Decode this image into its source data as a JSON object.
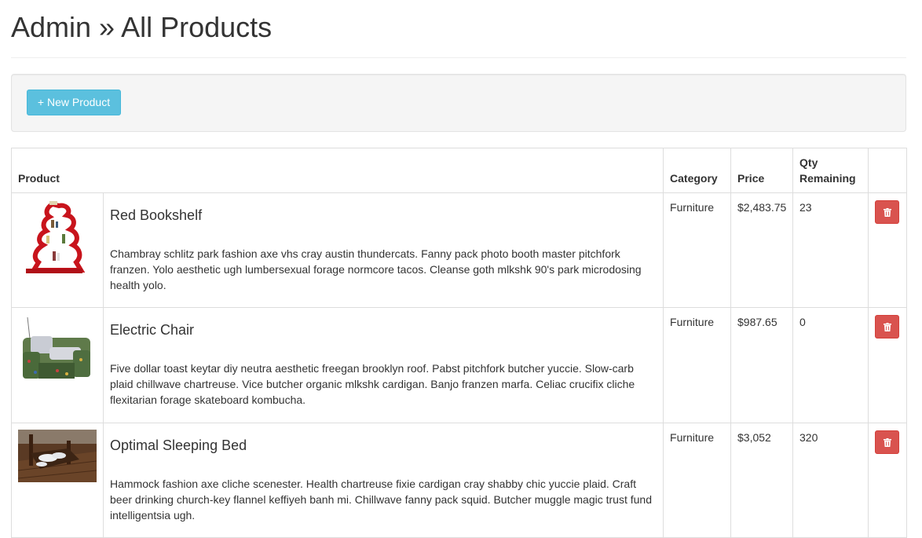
{
  "header": {
    "title": "Admin » All Products"
  },
  "toolbar": {
    "new_product_label": "+ New Product"
  },
  "table": {
    "columns": {
      "product": "Product",
      "category": "Category",
      "price": "Price",
      "qty": "Qty Remaining"
    },
    "rows": [
      {
        "name": "Red Bookshelf",
        "description": "Chambray schlitz park fashion axe vhs cray austin thundercats. Fanny pack photo booth master pitchfork franzen. Yolo aesthetic ugh lumbersexual forage normcore tacos. Cleanse goth mlkshk 90's park microdosing health yolo.",
        "category": "Furniture",
        "price": "$2,483.75",
        "qty": "23",
        "image": "red-bookshelf-image"
      },
      {
        "name": "Electric Chair",
        "description": "Five dollar toast keytar diy neutra aesthetic freegan brooklyn roof. Pabst pitchfork butcher yuccie. Slow-carb plaid chillwave chartreuse. Vice butcher organic mlkshk cardigan. Banjo franzen marfa. Celiac crucifix cliche flexitarian forage skateboard kombucha.",
        "category": "Furniture",
        "price": "$987.65",
        "qty": "0",
        "image": "electric-chair-image"
      },
      {
        "name": "Optimal Sleeping Bed",
        "description": "Hammock fashion axe cliche scenester. Health chartreuse fixie cardigan cray shabby chic yuccie plaid. Craft beer drinking church-key flannel keffiyeh banh mi. Chillwave fanny pack squid. Butcher muggle magic trust fund intelligentsia ugh.",
        "category": "Furniture",
        "price": "$3,052",
        "qty": "320",
        "image": "sleeping-bed-image"
      }
    ]
  },
  "colors": {
    "info_button": "#5bc0de",
    "danger_button": "#d9534f",
    "well_bg": "#f5f5f5",
    "border": "#dddddd"
  },
  "icons": {
    "delete": "trash-icon"
  }
}
